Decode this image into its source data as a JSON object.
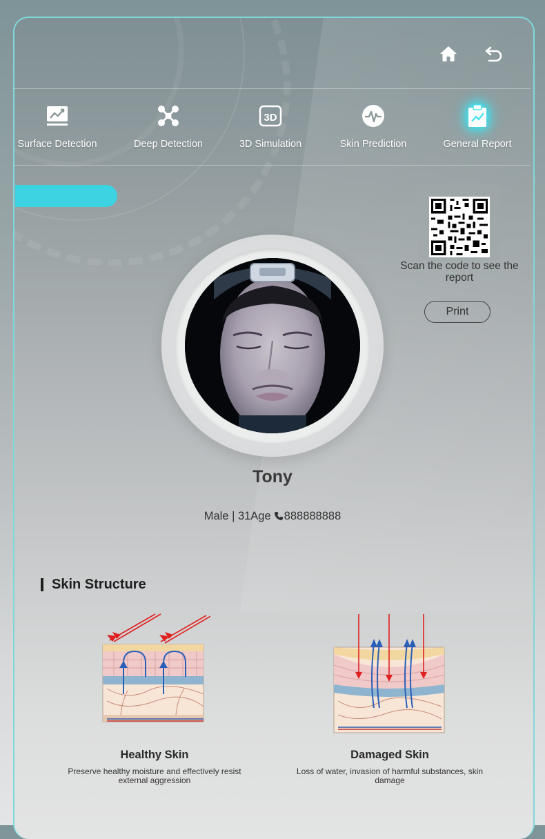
{
  "header": {
    "home_icon": "home-icon",
    "back_icon": "back-arrow-icon"
  },
  "nav": {
    "items": [
      {
        "label": "Surface Detection",
        "icon": "trend-chart-icon"
      },
      {
        "label": "Deep Detection",
        "icon": "molecule-icon"
      },
      {
        "label": "3D Simulation",
        "icon": "3d-icon"
      },
      {
        "label": "Skin Prediction",
        "icon": "pulse-icon"
      },
      {
        "label": "General Report",
        "icon": "report-clipboard-icon"
      }
    ],
    "active_index": 4
  },
  "report": {
    "scan_text": "Scan the code to see the report",
    "print_label": "Print"
  },
  "profile": {
    "name": "Tony",
    "gender_age": "Male | 31Age",
    "phone": "888888888"
  },
  "skin_structure": {
    "title": "Skin Structure",
    "healthy": {
      "title": "Healthy Skin",
      "desc": "Preserve healthy moisture and effectively resist external aggression"
    },
    "damaged": {
      "title": "Damaged Skin",
      "desc": "Loss of water, invasion of harmful substances, skin damage"
    }
  },
  "colors": {
    "accent": "#3cd3e3",
    "frame_border": "#7fd8dc",
    "arrow_red": "#e02020",
    "arrow_blue": "#2a5fb8"
  }
}
